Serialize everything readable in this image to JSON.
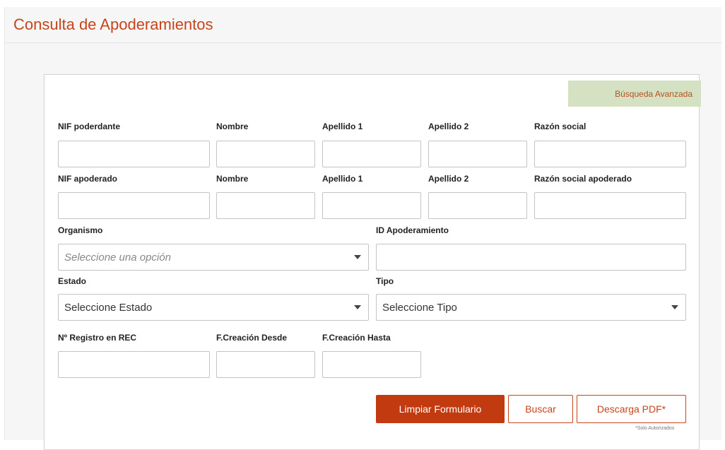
{
  "page": {
    "title": "Consulta de Apoderamientos"
  },
  "advanced_search": {
    "label": "Búsqueda Avanzada"
  },
  "row1": {
    "nif_poderdante": "NIF poderdante",
    "nombre": "Nombre",
    "apellido1": "Apellido 1",
    "apellido2": "Apellido 2",
    "razon_social": "Razón social"
  },
  "row2": {
    "nif_apoderado": "NIF apoderado",
    "nombre": "Nombre",
    "apellido1": "Apellido 1",
    "apellido2": "Apellido 2",
    "razon_social_apoderado": "Razón social apoderado"
  },
  "row3": {
    "organismo_label": "Organismo",
    "organismo_value": "Seleccione una opción",
    "id_apoderamiento_label": "ID Apoderamiento"
  },
  "row4": {
    "estado_label": "Estado",
    "estado_value": "Seleccione Estado",
    "tipo_label": "Tipo",
    "tipo_value": "Seleccione Tipo"
  },
  "row5": {
    "registro_label": "Nº Registro en REC",
    "fcreacion_desde_label": "F.Creación Desde",
    "fcreacion_hasta_label": "F.Creación Hasta"
  },
  "actions": {
    "limpiar": "Limpiar Formulario",
    "buscar": "Buscar",
    "descarga": "Descarga PDF*",
    "note": "*Solo Autorizados"
  },
  "colors": {
    "accent": "#c8441b",
    "primary_button": "#c23a0f",
    "advanced_bg": "#d4e2c3"
  }
}
